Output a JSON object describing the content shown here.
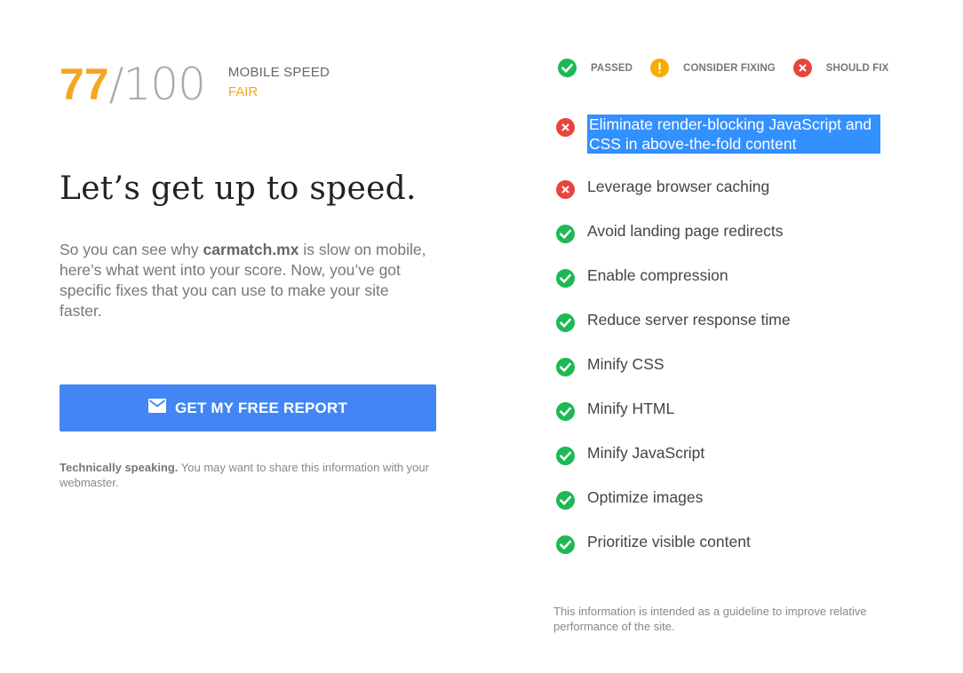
{
  "score": {
    "value": "77",
    "max": "/100",
    "label": "MOBILE SPEED",
    "rating": "FAIR",
    "colors": {
      "fair": "#f5a623"
    }
  },
  "headline": "Let’s get up to speed.",
  "intro": {
    "pre": "So you can see why ",
    "site": "carmatch.mx",
    "post": " is slow on mobile, here’s what went into your score. Now, you’ve got specific fixes that you can use to make your site faster."
  },
  "report_button": {
    "icon": "mail-icon",
    "label": "GET MY FREE REPORT",
    "color": "#4285f4"
  },
  "technically": {
    "bold": "Technically speaking.",
    "text": " You may want to share this information with your webmaster."
  },
  "legend": [
    {
      "status": "passed",
      "label": "PASSED",
      "icon": "check-circle-icon",
      "color": "#1db954"
    },
    {
      "status": "consider",
      "label": "CONSIDER FIXING",
      "icon": "exclamation-circle-icon",
      "color": "#f9ab00"
    },
    {
      "status": "fix",
      "label": "SHOULD FIX",
      "icon": "x-circle-icon",
      "color": "#e8453c"
    }
  ],
  "rules": [
    {
      "status": "fix",
      "text": "Eliminate render-blocking JavaScript and CSS in above-the-fold content",
      "selected": true
    },
    {
      "status": "fix",
      "text": "Leverage browser caching"
    },
    {
      "status": "passed",
      "text": "Avoid landing page redirects"
    },
    {
      "status": "passed",
      "text": "Enable compression"
    },
    {
      "status": "passed",
      "text": "Reduce server response time"
    },
    {
      "status": "passed",
      "text": "Minify CSS"
    },
    {
      "status": "passed",
      "text": "Minify HTML"
    },
    {
      "status": "passed",
      "text": "Minify JavaScript"
    },
    {
      "status": "passed",
      "text": "Optimize images"
    },
    {
      "status": "passed",
      "text": "Prioritize visible content"
    }
  ],
  "footnote": "This information is intended as a guideline to improve relative performance of the site."
}
